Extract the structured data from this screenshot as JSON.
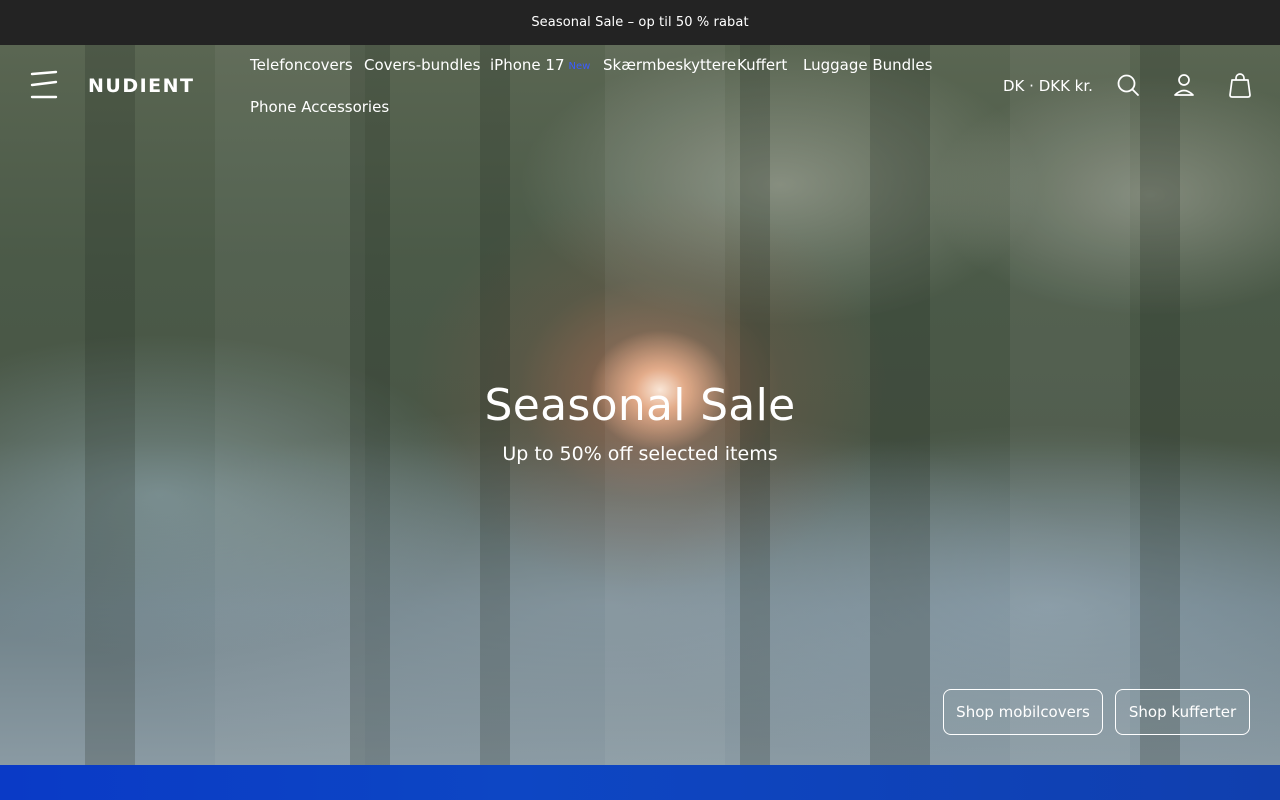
{
  "announcement": {
    "text": "Seasonal Sale – op til 50 % rabat"
  },
  "header": {
    "logo": "NUDIENT",
    "nav": [
      {
        "label": "Telefoncovers"
      },
      {
        "label": "Covers-bundles"
      },
      {
        "label": "iPhone 17",
        "badge": "New"
      },
      {
        "label": "Skærmbeskyttere"
      },
      {
        "label": "Kuffert"
      },
      {
        "label": "Luggage Bundles"
      },
      {
        "label": "Phone Accessories"
      }
    ],
    "currency": "DK · DKK kr.",
    "icons": [
      "menu-icon",
      "search-icon",
      "account-icon",
      "bag-icon"
    ]
  },
  "hero": {
    "title": "Seasonal Sale",
    "subtitle": "Up to 50% off selected items",
    "buttons": [
      {
        "label": "Shop mobilcovers"
      },
      {
        "label": "Shop kufferter"
      }
    ]
  },
  "colors": {
    "announcement_bg": "#232323",
    "badge": "#3b5bff",
    "bottom_band": "#0d46c4"
  }
}
